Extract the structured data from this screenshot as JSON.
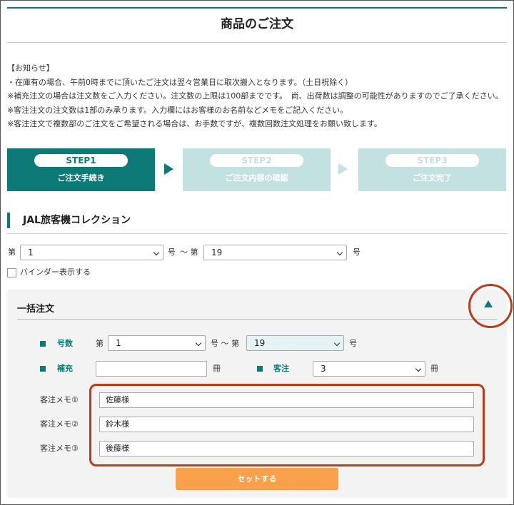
{
  "page": {
    "title": "商品のご注文"
  },
  "notice": {
    "lines": [
      "【お知らせ】",
      "・在庫有の場合、午前0時までに頂いたご注文は翌々営業日に取次搬入となります。（土日祝除く）",
      "※補充注文の場合は注文数をご入力ください。注文数の上限は100部までです。　尚、出荷数は調整の可能性がありますのでご了承ください。",
      "※客注注文の注文数は1部のみ承ります。入力欄にはお客様のお名前などメモをご記入ください。",
      "※客注注文で複数部のご注文をご希望される場合は、お手数ですが、複数回数注文処理をお願い致します。"
    ]
  },
  "steps": [
    {
      "label": "STEP1",
      "sub": "ご注文手続き",
      "state": "active"
    },
    {
      "label": "STEP2",
      "sub": "ご注文内容の確認",
      "state": "inactive"
    },
    {
      "label": "STEP3",
      "sub": "ご注文完了",
      "state": "inactive"
    }
  ],
  "collection": {
    "title": "JAL旅客機コレクション",
    "prefix": "第",
    "issue_suffix": "号",
    "tilde_prefix": "〜 第",
    "from_value": "1",
    "to_value": "19",
    "binder_label": "バインダー表示する"
  },
  "bulk": {
    "title": "一括注文",
    "issue_label": "号数",
    "prefix": "第",
    "from_value": "1",
    "tilde_prefix": "号 〜 第",
    "to_value": "19",
    "issue_suffix": "号",
    "supplement_label": "補充",
    "supplement_value": "",
    "unit": "冊",
    "customer_label": "客注",
    "customer_value": "3",
    "memos": [
      {
        "label": "客注メモ①",
        "value": "佐藤様"
      },
      {
        "label": "客注メモ②",
        "value": "鈴木様"
      },
      {
        "label": "客注メモ③",
        "value": "後藤様"
      }
    ],
    "set_button": "セットする"
  },
  "colors": {
    "accent": "#0d7a78",
    "step_inactive": "#c3e1e0",
    "button": "#f9a04a",
    "annotation": "#b83c1e"
  }
}
